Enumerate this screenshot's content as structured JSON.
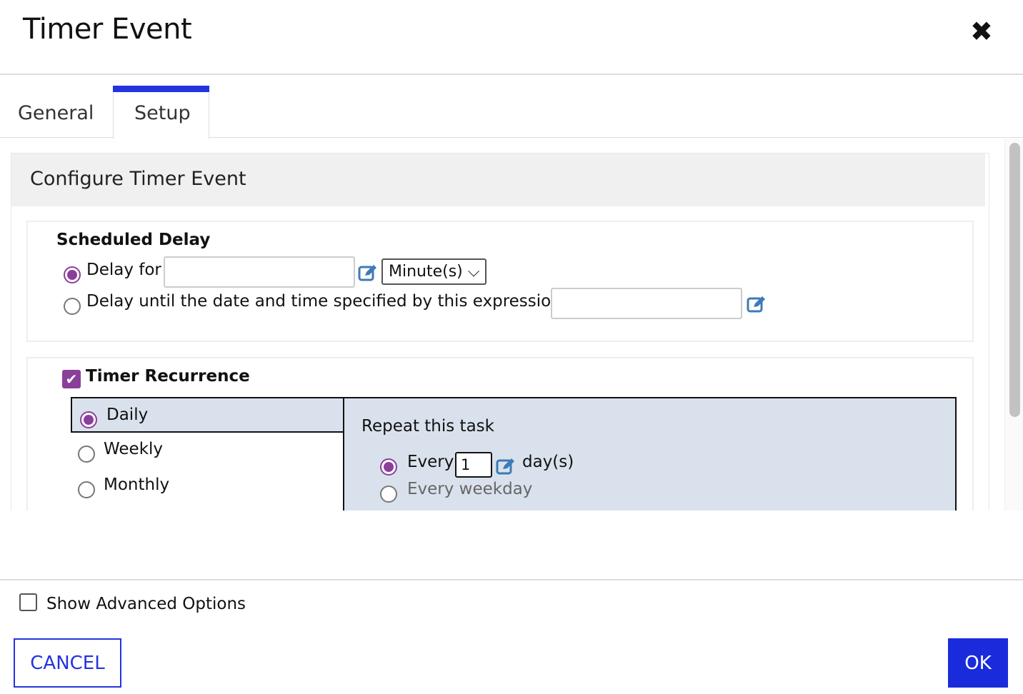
{
  "dialog": {
    "title": "Timer Event",
    "close_icon": "close-icon"
  },
  "tabs": [
    {
      "label": "General",
      "active": false
    },
    {
      "label": "Setup",
      "active": true
    }
  ],
  "accent_color": "#2433e0",
  "radio_color": "#8a3f9a",
  "panel": {
    "title": "Configure Timer Event"
  },
  "scheduled_delay": {
    "heading": "Scheduled Delay",
    "delay_for_label": "Delay for",
    "delay_for_value": "",
    "unit_selected": "Minute(s)",
    "delay_until_label": "Delay until the date and time specified by this expression:",
    "delay_until_value": "",
    "selected": "delay_for"
  },
  "recurrence": {
    "checkbox_label": "Timer Recurrence",
    "checked": true,
    "options": [
      {
        "label": "Daily",
        "selected": true
      },
      {
        "label": "Weekly",
        "selected": false
      },
      {
        "label": "Monthly",
        "selected": false
      }
    ],
    "repeat_heading": "Repeat this task",
    "every_label": "Every",
    "every_value": "1",
    "days_label": "day(s)",
    "weekday_label": "Every weekday",
    "selected": "every"
  },
  "footer": {
    "advanced_label": "Show Advanced Options",
    "advanced_checked": false,
    "cancel_label": "CANCEL",
    "ok_label": "OK"
  }
}
